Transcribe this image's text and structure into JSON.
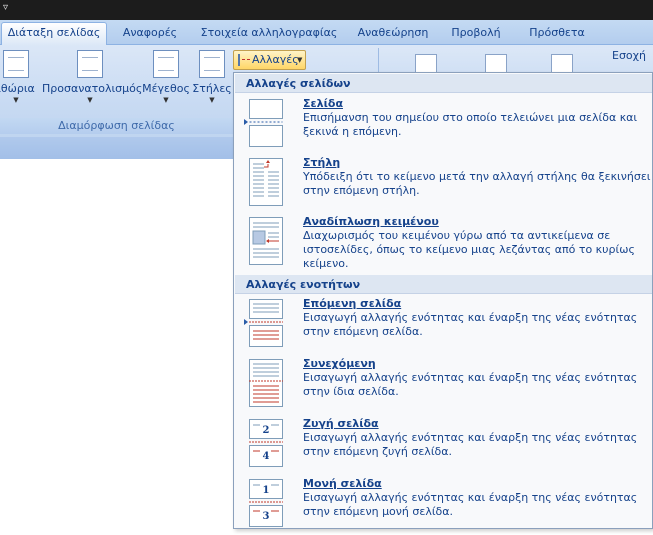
{
  "tabs": [
    {
      "label": "Διάταξη σελίδας",
      "active": true
    },
    {
      "label": "Αναφορές"
    },
    {
      "label": "Στοιχεία αλληλογραφίας"
    },
    {
      "label": "Αναθεώρηση"
    },
    {
      "label": "Προβολή"
    },
    {
      "label": "Πρόσθετα"
    }
  ],
  "ribbon": {
    "margins_label": "ιθώρια",
    "orientation_label": "Προσανατολισμός",
    "size_label": "Μέγεθος",
    "columns_label": "Στήλες",
    "breaks_label": "Αλλαγές",
    "group_label": "Διαμόρφωση σελίδας",
    "position_label": "Εσοχή"
  },
  "menu": {
    "page_breaks_header": "Αλλαγές σελίδων",
    "section_breaks_header": "Αλλαγές ενοτήτων",
    "page_items": [
      {
        "title": "Σελίδα",
        "desc": "Επισήμανση του σημείου στο οποίο τελειώνει μια σελίδα και ξεκινά η επόμενη.",
        "icon": "page-break-icon"
      },
      {
        "title": "Στήλη",
        "desc": "Υπόδειξη ότι το κείμενο μετά την αλλαγή στήλης θα ξεκινήσει στην επόμενη στήλη.",
        "icon": "column-break-icon"
      },
      {
        "title": "Αναδίπλωση κειμένου",
        "desc": "Διαχωρισμός του κειμένου γύρω από τα αντικείμενα σε ιστοσελίδες, όπως το κείμενο μιας λεζάντας από το κυρίως κείμενο.",
        "icon": "text-wrapping-break-icon"
      }
    ],
    "section_items": [
      {
        "title": "Επόμενη σελίδα",
        "desc": "Εισαγωγή αλλαγής ενότητας και έναρξη της νέας ενότητας στην επόμενη σελίδα.",
        "icon": "next-page-section-icon"
      },
      {
        "title": "Συνεχόμενη",
        "desc": "Εισαγωγή αλλαγής ενότητας και έναρξη της νέας ενότητας στην ίδια σελίδα.",
        "icon": "continuous-section-icon"
      },
      {
        "title": "Ζυγή σελίδα",
        "desc": "Εισαγωγή αλλαγής ενότητας και έναρξη της νέας ενότητας στην επόμενη ζυγή σελίδα.",
        "icon": "even-page-section-icon",
        "thumb_numbers": [
          "2",
          "4"
        ]
      },
      {
        "title": "Μονή σελίδα",
        "desc": "Εισαγωγή αλλαγής ενότητας και έναρξη της νέας ενότητας στην επόμενη μονή σελίδα.",
        "icon": "odd-page-section-icon",
        "thumb_numbers": [
          "1",
          "3"
        ]
      }
    ]
  },
  "colors": {
    "accent": "#15428b",
    "break_mark": "#c0392b",
    "ribbon": "#c9dbf3"
  }
}
